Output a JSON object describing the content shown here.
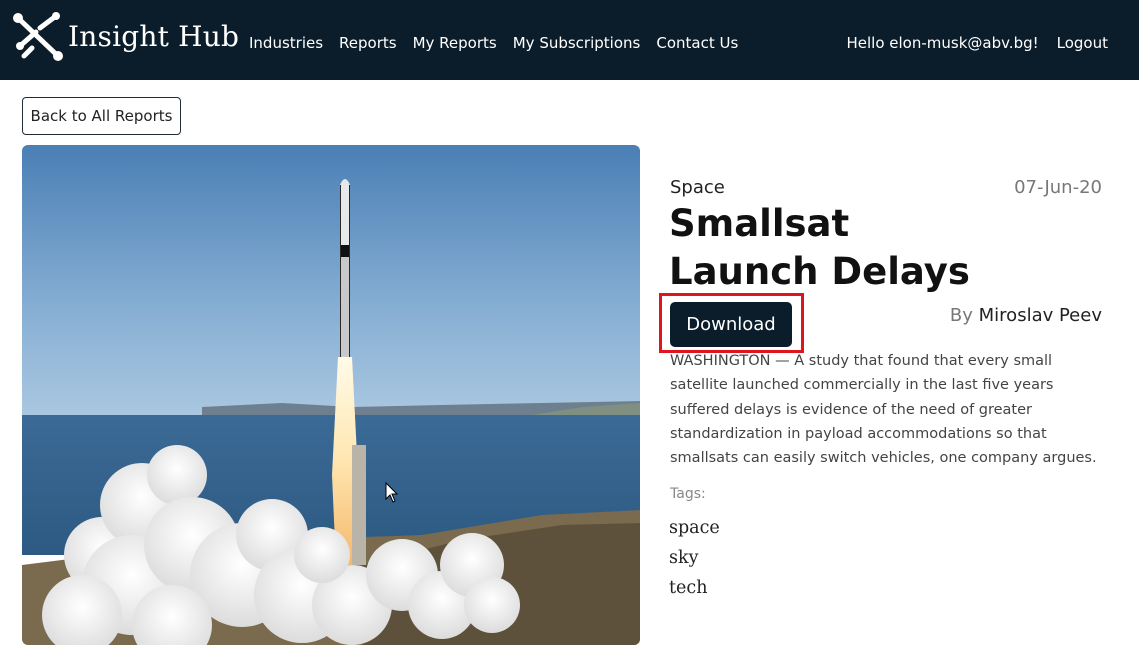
{
  "navbar": {
    "brand": "Insight Hub",
    "links": [
      "Industries",
      "Reports",
      "My Reports",
      "My Subscriptions",
      "Contact Us"
    ],
    "greeting": "Hello elon-musk@abv.bg!",
    "logout": "Logout",
    "background": "#0b1d2a"
  },
  "back_button": "Back to All Reports",
  "report": {
    "category": "Space",
    "date": "07-Jun-20",
    "title": "Smallsat Launch Delays",
    "download_label": "Download",
    "author_prefix": "By",
    "author": "Miroslav Peev",
    "summary": "WASHINGTON — A study that found that every small satellite launched commercially in the last five years suffered delays is evidence of the need of greater standardization in payload accommodations so that smallsats can easily switch vehicles, one company argues.",
    "tags_label": "Tags:",
    "tags": [
      "space",
      "sky",
      "tech"
    ],
    "image_icon": "rocket-launch-photo"
  },
  "highlight_color": "#e0141e"
}
